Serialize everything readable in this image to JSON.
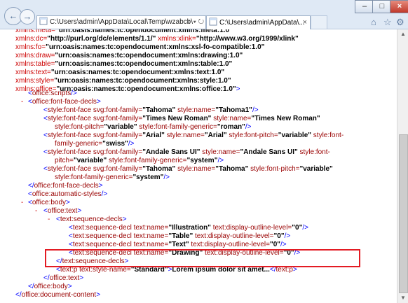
{
  "window": {
    "address": "C:\\Users\\admin\\AppData\\Local\\Temp\\wzabcb\\",
    "search_glyph": "⌕",
    "tab_title": "C:\\Users\\admin\\AppData\\...",
    "tab_close": "×",
    "buttons": {
      "minimize": "–",
      "maximize": "□",
      "close": "×"
    },
    "icons": {
      "back": "←",
      "forward": "→",
      "home": "⌂",
      "favorites": "☆",
      "tools": "⚙"
    }
  },
  "xml": {
    "nsdecl": [
      {
        "name": "xmlns:meta=",
        "value": "\"urn:oasis:names:tc:opendocument:xmlns:meta:1.0\""
      },
      {
        "name": "xmlns:dc=",
        "value": "\"http://purl.org/dc/elements/1.1/\"",
        "name2": " xmlns:xlink=",
        "value2": "\"http://www.w3.org/1999/xlink\""
      },
      {
        "name": "xmlns:fo=",
        "value": "\"urn:oasis:names:tc:opendocument:xmlns:xsl-fo-compatible:1.0\""
      },
      {
        "name": "xmlns:draw=",
        "value": "\"urn:oasis:names:tc:opendocument:xmlns:drawing:1.0\""
      },
      {
        "name": "xmlns:table=",
        "value": "\"urn:oasis:names:tc:opendocument:xmlns:table:1.0\""
      },
      {
        "name": "xmlns:text=",
        "value": "\"urn:oasis:names:tc:opendocument:xmlns:text:1.0\""
      },
      {
        "name": "xmlns:style=",
        "value": "\"urn:oasis:names:tc:opendocument:xmlns:style:1.0\""
      },
      {
        "name": "xmlns:office=",
        "value": "\"urn:oasis:names:tc:opendocument:xmlns:office:1.0\"",
        "end": ">"
      }
    ],
    "toggle": "-",
    "office_scripts": "office:scripts",
    "font_face_decls": "office:font-face-decls",
    "font_faces": [
      {
        "l1": [
          [
            "svg:font-family=",
            "\"Tahoma\""
          ],
          [
            "style:name=",
            "\"Tahoma1\""
          ]
        ],
        "l1end": "/>"
      },
      {
        "l1": [
          [
            "svg:font-family=",
            "\"Times New Roman\""
          ],
          [
            "style:name=",
            "\"Times New Roman\""
          ]
        ],
        "l2": [
          [
            "style:font-pitch=",
            "\"variable\""
          ],
          [
            "style:font-family-generic=",
            "\"roman\""
          ]
        ],
        "l2end": "/>"
      },
      {
        "l1": [
          [
            "svg:font-family=",
            "\"Arial\""
          ],
          [
            "style:name=",
            "\"Arial\""
          ],
          [
            "style:font-pitch=",
            "\"variable\""
          ],
          [
            "style:font-",
            ""
          ]
        ],
        "l2": [
          [
            "family-generic=",
            "\"swiss\""
          ]
        ],
        "l2end": "/>"
      },
      {
        "l1": [
          [
            "svg:font-family=",
            "\"Andale Sans UI\""
          ],
          [
            "style:name=",
            "\"Andale Sans UI\""
          ],
          [
            "style:font-",
            ""
          ]
        ],
        "l2": [
          [
            "pitch=",
            "\"variable\""
          ],
          [
            "style:font-family-generic=",
            "\"system\""
          ]
        ],
        "l2end": "/>"
      },
      {
        "l1": [
          [
            "svg:font-family=",
            "\"Tahoma\""
          ],
          [
            "style:name=",
            "\"Tahoma\""
          ],
          [
            "style:font-pitch=",
            "\"variable\""
          ]
        ],
        "l2": [
          [
            "style:font-family-generic=",
            "\"system\""
          ]
        ],
        "l2end": "/>"
      }
    ],
    "font_face_tag": "style:font-face",
    "automatic_styles": "office:automatic-styles",
    "body": "office:body",
    "office_text": "office:text",
    "sequence_decls": "text:sequence-decls",
    "sequence_decl_tag": "text:sequence-decl",
    "sequence_items": [
      "Illustration",
      "Table",
      "Text",
      "Drawing"
    ],
    "attr_name": "text:name=",
    "attr_level": "text:display-outline-level=",
    "level_value": "\"0\"",
    "para_tag": "text:p",
    "para_attr": "text:style-name=",
    "para_style": "\"Standard\"",
    "para_text": "Lorem ipsum dolor sit amet...",
    "document_content": "office:document-content"
  },
  "colors": {
    "highlight": "#e31b23",
    "markup": "#0000ff",
    "tag": "#990000",
    "ns_name": "#cc0000"
  }
}
